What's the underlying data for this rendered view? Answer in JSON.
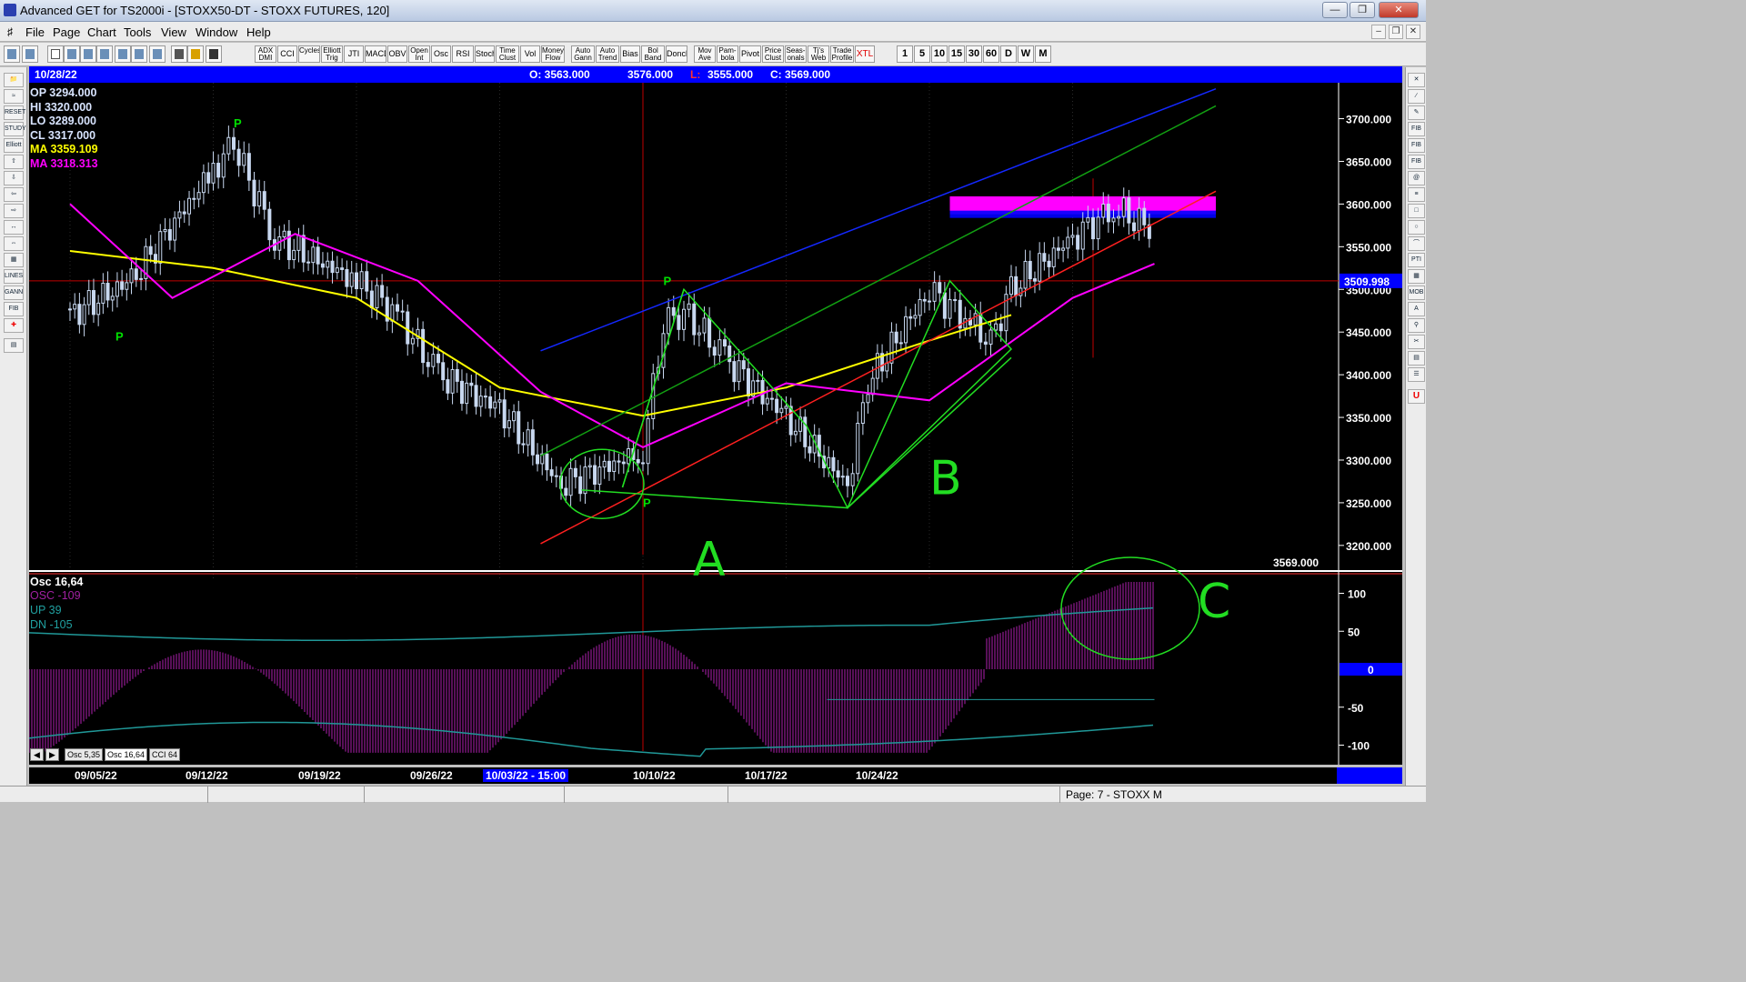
{
  "window": {
    "title": "Advanced GET for TS2000i - [STOXX50-DT - STOXX FUTURES, 120]"
  },
  "menu": [
    "File",
    "Page",
    "Chart",
    "Tools",
    "View",
    "Window",
    "Help"
  ],
  "toolbar": {
    "studies": [
      "ADX DMI",
      "CCI",
      "Cycles",
      "Elliott Trig",
      "JTI",
      "MACD",
      "OBV",
      "Open Int",
      "Osc",
      "RSI",
      "Stoch",
      "Time Clust",
      "Vol",
      "Money Flow",
      "Auto Gann",
      "Auto Trend",
      "Bias",
      "Bol Band",
      "Donch",
      "Mov Ave",
      "Pam- bola",
      "Pivot",
      "Price Clust",
      "Seas- onals",
      "Tj's Web",
      "Trade Profile",
      "XTL"
    ],
    "timeframes": [
      "1",
      "5",
      "10",
      "15",
      "30",
      "60",
      "D",
      "W",
      "M"
    ]
  },
  "header": {
    "date": "10/28/22",
    "open": "O: 3563.000",
    "high": "3576.000",
    "low_label": "L:",
    "low": "3555.000",
    "close": "C: 3569.000"
  },
  "stats": [
    {
      "text": "OP  3294.000",
      "color": "#d8e4ff"
    },
    {
      "text": "HI   3320.000",
      "color": "#d8e4ff"
    },
    {
      "text": "LO  3289.000",
      "color": "#d8e4ff"
    },
    {
      "text": "CL  3317.000",
      "color": "#d8e4ff"
    },
    {
      "text": "MA  3359.109",
      "color": "#ffff00"
    },
    {
      "text": "MA  3318.313",
      "color": "#ff00ff"
    }
  ],
  "price_axis": {
    "ticks": [
      "3700.000",
      "3650.000",
      "3600.000",
      "3550.000",
      "3500.000",
      "3450.000",
      "3400.000",
      "3350.000",
      "3300.000",
      "3250.000",
      "3200.000"
    ],
    "highlight": "3509.998",
    "last_price": "3569.000"
  },
  "pivot_labels": [
    "P",
    "P",
    "P",
    "P"
  ],
  "annotations": [
    "A",
    "B",
    "C"
  ],
  "oscillator": {
    "title": "Osc 16,64",
    "rows": [
      {
        "text": "OSC -109",
        "color": "#a020a0"
      },
      {
        "text": "UP    39",
        "color": "#20a0a0"
      },
      {
        "text": "DN   -105",
        "color": "#20a0a0"
      }
    ],
    "ticks": [
      "100",
      "50",
      "0",
      "-50",
      "-100"
    ],
    "tabs": [
      "Osc 5,35",
      "Osc 16,64",
      "CCI 64"
    ]
  },
  "date_axis": [
    "09/05/22",
    "09/12/22",
    "09/19/22",
    "09/26/22",
    "10/03/22 - 15:00",
    "10/10/22",
    "10/17/22",
    "10/24/22"
  ],
  "status": {
    "page": "Page: 7 - STOXX M"
  },
  "chart_data": {
    "type": "candlestick",
    "title": "STOXX50-DT - STOXX FUTURES, 120",
    "x_range": [
      "09/05/22",
      "10/28/22"
    ],
    "ylim": [
      3170,
      3740
    ],
    "price_path": [
      {
        "date": "09/05/22",
        "price": 3470
      },
      {
        "date": "09/08/22",
        "price": 3510
      },
      {
        "date": "09/12/22",
        "price": 3640
      },
      {
        "date": "09/13/22",
        "price": 3670
      },
      {
        "date": "09/15/22",
        "price": 3560
      },
      {
        "date": "09/19/22",
        "price": 3510
      },
      {
        "date": "09/21/22",
        "price": 3470
      },
      {
        "date": "09/23/22",
        "price": 3400
      },
      {
        "date": "09/26/22",
        "price": 3360
      },
      {
        "date": "09/29/22",
        "price": 3270
      },
      {
        "date": "10/03/22",
        "price": 3310
      },
      {
        "date": "10/04/22",
        "price": 3460
      },
      {
        "date": "10/05/22",
        "price": 3475
      },
      {
        "date": "10/07/22",
        "price": 3420
      },
      {
        "date": "10/10/22",
        "price": 3350
      },
      {
        "date": "10/13/22",
        "price": 3270
      },
      {
        "date": "10/14/22",
        "price": 3390
      },
      {
        "date": "10/17/22",
        "price": 3500
      },
      {
        "date": "10/19/22",
        "price": 3460
      },
      {
        "date": "10/20/22",
        "price": 3440
      },
      {
        "date": "10/21/22",
        "price": 3500
      },
      {
        "date": "10/24/22",
        "price": 3560
      },
      {
        "date": "10/26/22",
        "price": 3595
      },
      {
        "date": "10/28/22",
        "price": 3569
      }
    ],
    "ma_yellow": [
      {
        "date": "09/05/22",
        "price": 3545
      },
      {
        "date": "09/12/22",
        "price": 3525
      },
      {
        "date": "09/19/22",
        "price": 3490
      },
      {
        "date": "09/26/22",
        "price": 3385
      },
      {
        "date": "10/03/22",
        "price": 3352
      },
      {
        "date": "10/10/22",
        "price": 3385
      },
      {
        "date": "10/17/22",
        "price": 3440
      },
      {
        "date": "10/21/22",
        "price": 3470
      }
    ],
    "ma_magenta": [
      {
        "date": "09/05/22",
        "price": 3600
      },
      {
        "date": "09/10/22",
        "price": 3490
      },
      {
        "date": "09/16/22",
        "price": 3565
      },
      {
        "date": "09/22/22",
        "price": 3510
      },
      {
        "date": "09/28/22",
        "price": 3380
      },
      {
        "date": "10/03/22",
        "price": 3315
      },
      {
        "date": "10/10/22",
        "price": 3390
      },
      {
        "date": "10/17/22",
        "price": 3370
      },
      {
        "date": "10/24/22",
        "price": 3490
      },
      {
        "date": "10/28/22",
        "price": 3530
      }
    ],
    "channel_lines": [
      {
        "name": "blue",
        "color": "#1428ff",
        "from": {
          "date": "09/28/22",
          "price": 3428
        },
        "to": {
          "date": "10/31/22",
          "price": 3735
        }
      },
      {
        "name": "green",
        "color": "#12a012",
        "from": {
          "date": "09/28/22",
          "price": 3305
        },
        "to": {
          "date": "10/31/22",
          "price": 3715
        }
      },
      {
        "name": "red",
        "color": "#ff2020",
        "from": {
          "date": "09/28/22",
          "price": 3202
        },
        "to": {
          "date": "10/31/22",
          "price": 3615
        }
      }
    ],
    "resistance_zone": {
      "from_date": "10/18/22",
      "to_date": "10/31/22",
      "price_low": 3588,
      "price_high": 3609
    },
    "cursor": {
      "date": "10/03/22",
      "price": 3509.998
    }
  }
}
